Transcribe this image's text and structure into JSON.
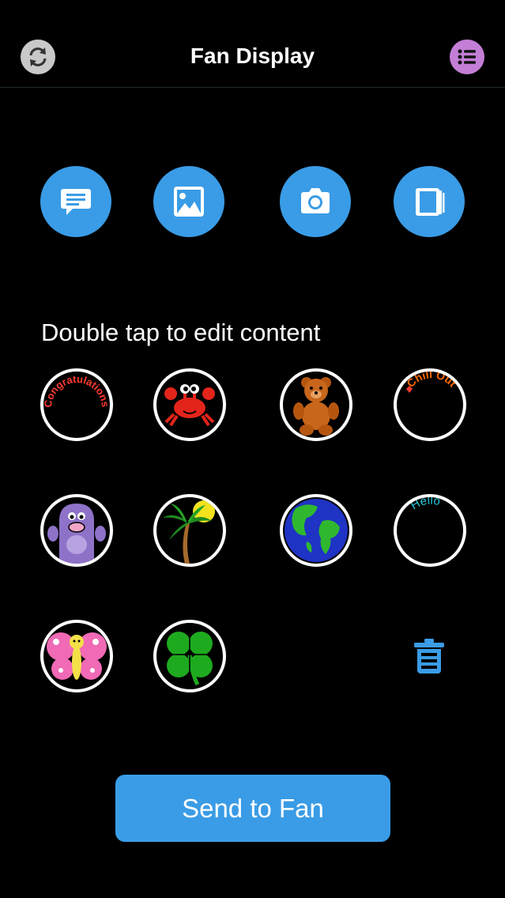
{
  "header": {
    "title": "Fan Display",
    "sync_icon": "sync-icon",
    "menu_icon": "list-icon",
    "menu_color": "#c37ed6"
  },
  "actions": [
    {
      "icon": "message-icon"
    },
    {
      "icon": "image-icon"
    },
    {
      "icon": "camera-icon"
    },
    {
      "icon": "book-icon"
    }
  ],
  "accent_color": "#3a9ce6",
  "hint": "Double tap to edit content",
  "slots": [
    {
      "kind": "text",
      "text": "Congratulations"
    },
    {
      "kind": "image",
      "icon": "crab-icon"
    },
    {
      "kind": "image",
      "icon": "teddy-bear-icon"
    },
    {
      "kind": "text",
      "text": "Chill Out"
    },
    {
      "kind": "image",
      "icon": "purple-monster-icon"
    },
    {
      "kind": "image",
      "icon": "palm-tree-icon"
    },
    {
      "kind": "image",
      "icon": "earth-icon"
    },
    {
      "kind": "text",
      "text": "Hello"
    },
    {
      "kind": "image",
      "icon": "butterfly-icon"
    },
    {
      "kind": "image",
      "icon": "four-leaf-clover-icon"
    }
  ],
  "trash_icon": "trash-icon",
  "send_button": "Send to Fan"
}
